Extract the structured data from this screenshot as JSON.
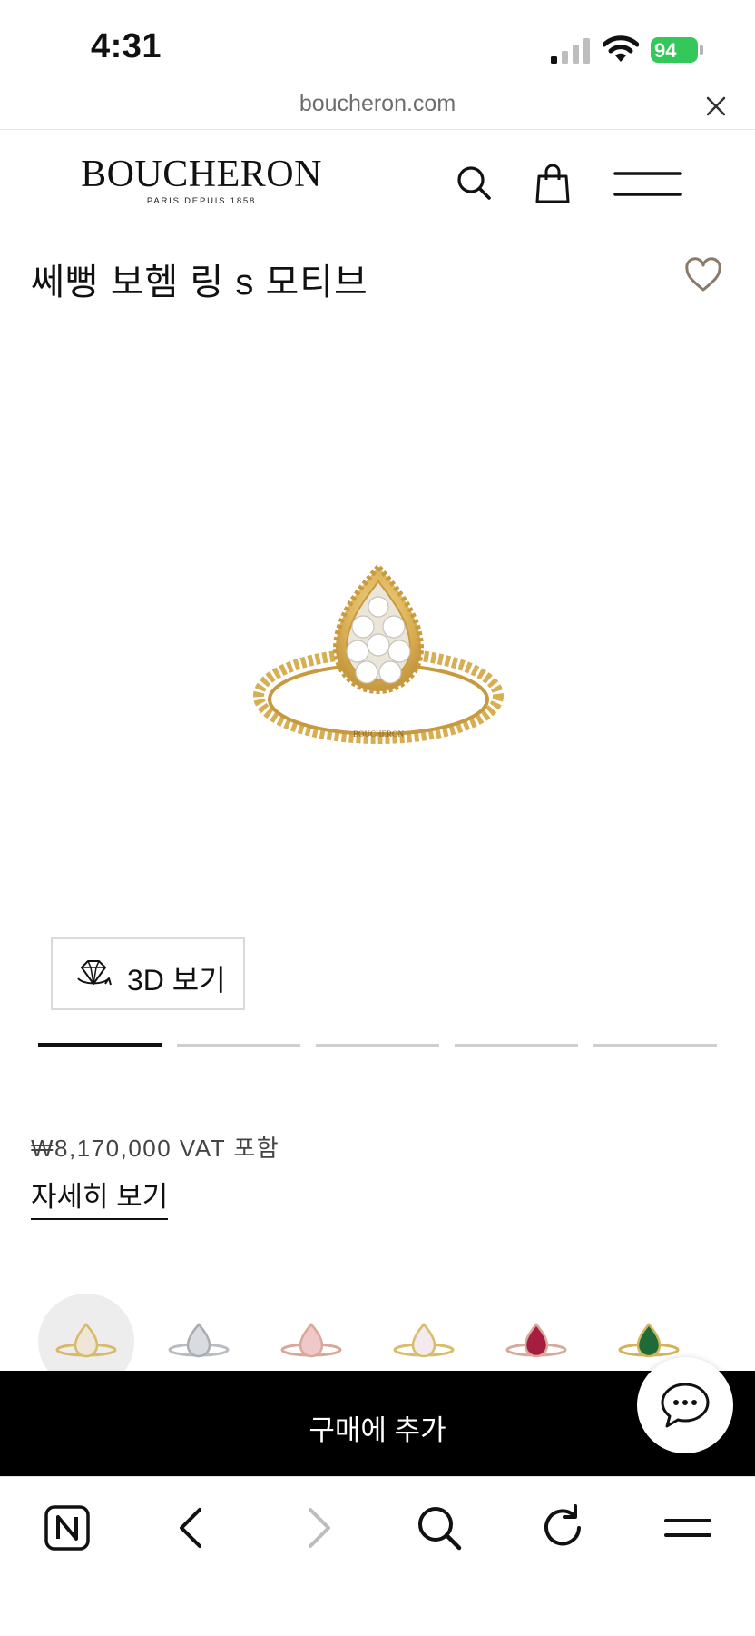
{
  "status_bar": {
    "time": "4:31",
    "battery": "94"
  },
  "browser": {
    "url": "boucheron.com"
  },
  "header": {
    "logo": "BOUCHERON",
    "logo_sub": "PARIS DEPUIS 1858"
  },
  "product": {
    "title": "쎄뻥 보헴 링 s 모티브",
    "view_3d_label": "3D 보기",
    "slides": {
      "count": 5,
      "active": 0
    },
    "price": "₩8,170,000 VAT 포함",
    "details_link": "자세히 보기",
    "variants": [
      {
        "name": "white-mother-of-pearl",
        "stone_color": "#efe6d8",
        "metal_color": "#d9b96a",
        "selected": true
      },
      {
        "name": "diamond-white-gold",
        "stone_color": "#d8dbe0",
        "metal_color": "#b9bcc2",
        "selected": false
      },
      {
        "name": "pink-opal",
        "stone_color": "#efc8c8",
        "metal_color": "#d9a899",
        "selected": false
      },
      {
        "name": "white-opal-yellow-gold",
        "stone_color": "#f3e9ef",
        "metal_color": "#d8bd6a",
        "selected": false
      },
      {
        "name": "rubellite",
        "stone_color": "#a61e3f",
        "metal_color": "#d8aa9b",
        "selected": false
      },
      {
        "name": "malachite",
        "stone_color": "#1f6b37",
        "metal_color": "#d3b45d",
        "selected": false
      }
    ]
  },
  "cta": {
    "add_to_cart": "구매에 추가"
  },
  "colors": {
    "gold": "#d6ad52",
    "black": "#000000",
    "accent_heart": "#8a7a6a"
  }
}
